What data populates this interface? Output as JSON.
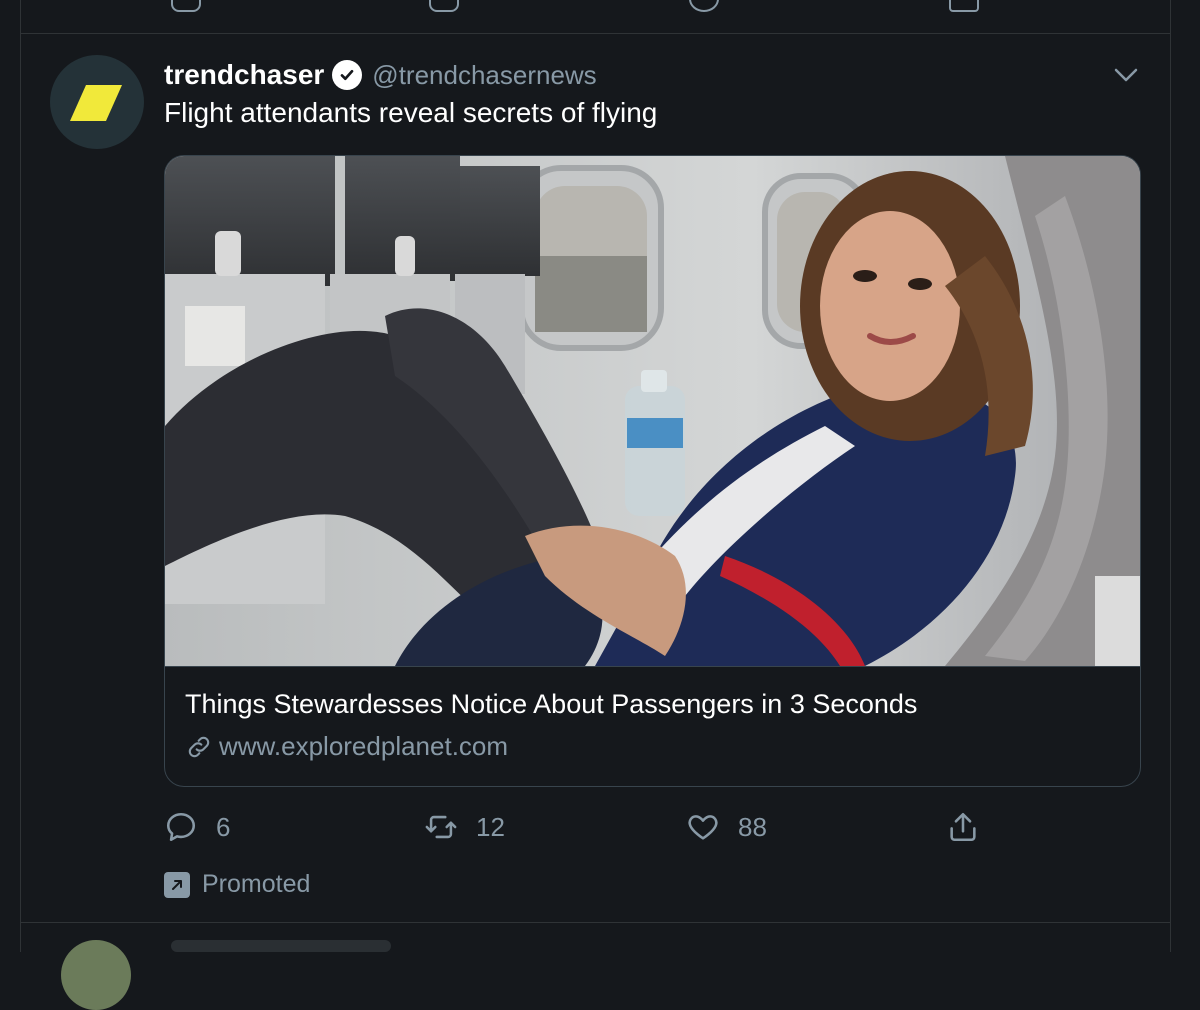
{
  "colors": {
    "background": "#15181c",
    "border": "#2f3336",
    "secondary_text": "#8899a6",
    "primary_text": "#ffffff",
    "avatar_bg": "#243238",
    "avatar_mark": "#f1e93a"
  },
  "tweet": {
    "display_name": "trendchaser",
    "verified_icon": "verified-badge-icon",
    "handle": "@trendchasernews",
    "text": "Flight attendants reveal secrets of flying",
    "card": {
      "image_icon": "flight-attendant-photo",
      "title": "Things Stewardesses Notice About Passengers in 3 Seconds",
      "link_icon": "link-icon",
      "url": "www.exploredplanet.com"
    },
    "actions": {
      "reply_count": "6",
      "retweet_count": "12",
      "like_count": "88"
    },
    "promoted_label": "Promoted"
  }
}
